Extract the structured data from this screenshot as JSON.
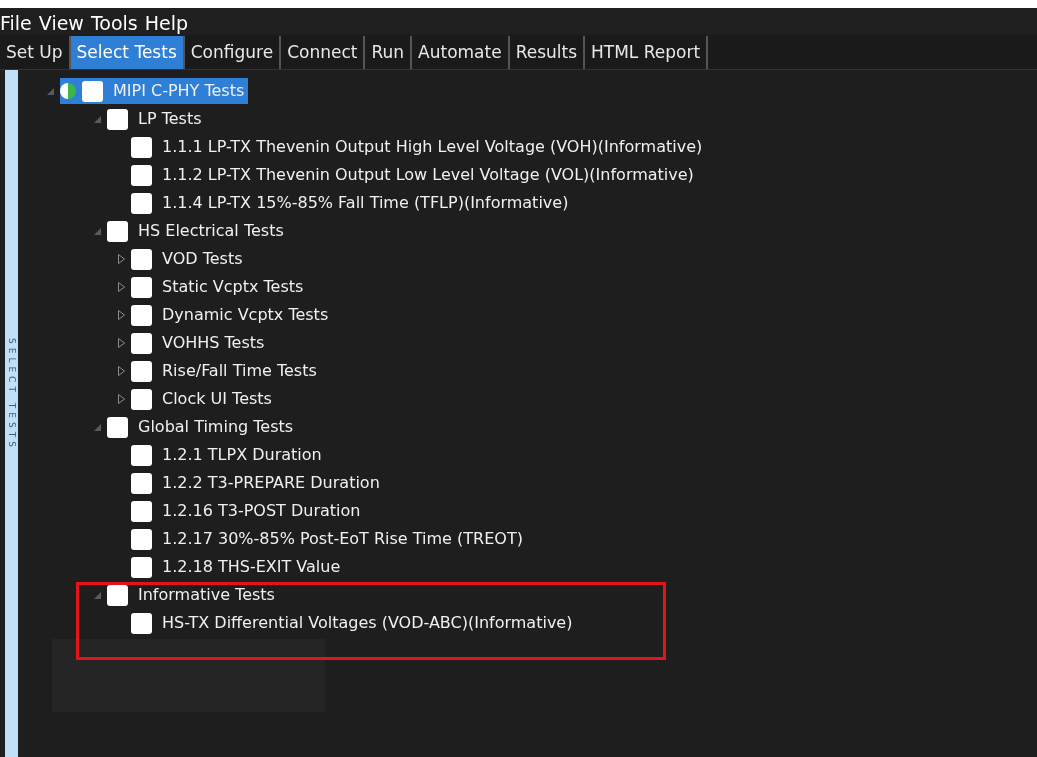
{
  "menu": [
    "File",
    "View",
    "Tools",
    "Help"
  ],
  "tabs": [
    {
      "label": "Set Up",
      "selected": false
    },
    {
      "label": "Select Tests",
      "selected": true
    },
    {
      "label": "Configure",
      "selected": false
    },
    {
      "label": "Connect",
      "selected": false
    },
    {
      "label": "Run",
      "selected": false
    },
    {
      "label": "Automate",
      "selected": false
    },
    {
      "label": "Results",
      "selected": false
    },
    {
      "label": "HTML Report",
      "selected": false
    }
  ],
  "side_label": "SELECT TESTS",
  "tree": [
    {
      "label": "MIPI C-PHY Tests",
      "checked": false,
      "selected": true,
      "expanded": true,
      "partially_checked": true,
      "children": [
        {
          "label": "LP Tests",
          "checked": false,
          "selected": false,
          "expanded": true,
          "children": [
            {
              "label": "1.1.1 LP-TX Thevenin Output High Level Voltage (VOH)(Informative)",
              "checked": false,
              "selected": false
            },
            {
              "label": "1.1.2 LP-TX Thevenin Output Low Level Voltage (VOL)(Informative)",
              "checked": false,
              "selected": false
            },
            {
              "label": "1.1.4 LP-TX 15%-85% Fall Time (TFLP)(Informative)",
              "checked": false,
              "selected": false
            }
          ]
        },
        {
          "label": "HS Electrical Tests",
          "checked": false,
          "selected": false,
          "expanded": true,
          "children": [
            {
              "label": "VOD Tests",
              "checked": false,
              "selected": false,
              "expanded": false
            },
            {
              "label": "Static Vcptx Tests",
              "checked": false,
              "selected": false,
              "expanded": false
            },
            {
              "label": "Dynamic Vcptx Tests",
              "checked": false,
              "selected": false,
              "expanded": false
            },
            {
              "label": "VOHHS Tests",
              "checked": false,
              "selected": false,
              "expanded": false
            },
            {
              "label": "Rise/Fall Time Tests",
              "checked": false,
              "selected": false,
              "expanded": false
            },
            {
              "label": "Clock UI Tests",
              "checked": false,
              "selected": false,
              "expanded": false
            }
          ]
        },
        {
          "label": "Global Timing Tests",
          "checked": false,
          "selected": false,
          "expanded": true,
          "children": [
            {
              "label": "1.2.1 TLPX Duration",
              "checked": false,
              "selected": false
            },
            {
              "label": "1.2.2 T3-PREPARE Duration",
              "checked": false,
              "selected": false
            },
            {
              "label": "1.2.16 T3-POST Duration",
              "checked": false,
              "selected": false
            },
            {
              "label": "1.2.17 30%-85% Post-EoT Rise Time (TREOT)",
              "checked": false,
              "selected": false
            },
            {
              "label": "1.2.18 THS-EXIT Value",
              "checked": false,
              "selected": false
            }
          ]
        },
        {
          "label": "Informative Tests",
          "checked": false,
          "selected": false,
          "expanded": true,
          "children": [
            {
              "label": "HS-TX Differential Voltages (VOD-ABC)(Informative)",
              "checked": false,
              "selected": false
            }
          ]
        }
      ]
    }
  ]
}
